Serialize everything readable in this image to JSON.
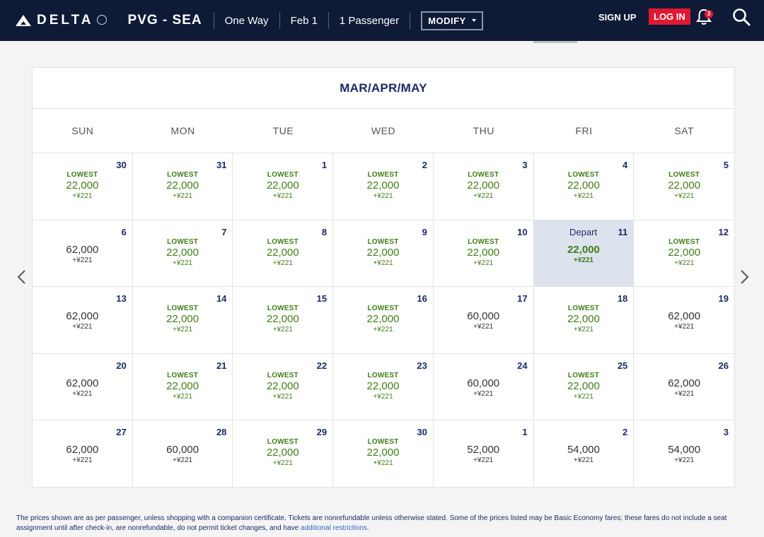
{
  "header": {
    "brand": "DELTA",
    "route": "PVG - SEA",
    "trip_type": "One Way",
    "date": "Feb 1",
    "passengers": "1 Passenger",
    "modify_label": "MODIFY",
    "signup_label": "SIGN UP",
    "login_label": "LOG IN",
    "notification_count": "3",
    "icons": {
      "search": "search-icon",
      "bell": "bell-icon",
      "dropdown": "chevron-down-icon"
    }
  },
  "calendar": {
    "title": "MAR/APR/MAY",
    "weekdays": [
      "SUN",
      "MON",
      "TUE",
      "WED",
      "THU",
      "FRI",
      "SAT"
    ],
    "lowest_label": "LOWEST",
    "depart_label": "Depart",
    "selected_day": "11",
    "days": [
      {
        "day": "30",
        "lowest": true,
        "price": "22,000",
        "tax": "+¥221"
      },
      {
        "day": "31",
        "lowest": true,
        "price": "22,000",
        "tax": "+¥221"
      },
      {
        "day": "1",
        "lowest": true,
        "price": "22,000",
        "tax": "+¥221"
      },
      {
        "day": "2",
        "lowest": true,
        "price": "22,000",
        "tax": "+¥221"
      },
      {
        "day": "3",
        "lowest": true,
        "price": "22,000",
        "tax": "+¥221"
      },
      {
        "day": "4",
        "lowest": true,
        "price": "22,000",
        "tax": "+¥221"
      },
      {
        "day": "5",
        "lowest": true,
        "price": "22,000",
        "tax": "+¥221"
      },
      {
        "day": "6",
        "lowest": false,
        "price": "62,000",
        "tax": "+¥221"
      },
      {
        "day": "7",
        "lowest": true,
        "price": "22,000",
        "tax": "+¥221"
      },
      {
        "day": "8",
        "lowest": true,
        "price": "22,000",
        "tax": "+¥221"
      },
      {
        "day": "9",
        "lowest": true,
        "price": "22,000",
        "tax": "+¥221"
      },
      {
        "day": "10",
        "lowest": true,
        "price": "22,000",
        "tax": "+¥221"
      },
      {
        "day": "11",
        "lowest": false,
        "selected": true,
        "price": "22,000",
        "tax": "+¥221"
      },
      {
        "day": "12",
        "lowest": true,
        "price": "22,000",
        "tax": "+¥221"
      },
      {
        "day": "13",
        "lowest": false,
        "price": "62,000",
        "tax": "+¥221"
      },
      {
        "day": "14",
        "lowest": true,
        "price": "22,000",
        "tax": "+¥221"
      },
      {
        "day": "15",
        "lowest": true,
        "price": "22,000",
        "tax": "+¥221"
      },
      {
        "day": "16",
        "lowest": true,
        "price": "22,000",
        "tax": "+¥221"
      },
      {
        "day": "17",
        "lowest": false,
        "price": "60,000",
        "tax": "+¥221"
      },
      {
        "day": "18",
        "lowest": true,
        "price": "22,000",
        "tax": "+¥221"
      },
      {
        "day": "19",
        "lowest": false,
        "price": "62,000",
        "tax": "+¥221"
      },
      {
        "day": "20",
        "lowest": false,
        "price": "62,000",
        "tax": "+¥221"
      },
      {
        "day": "21",
        "lowest": true,
        "price": "22,000",
        "tax": "+¥221"
      },
      {
        "day": "22",
        "lowest": true,
        "price": "22,000",
        "tax": "+¥221"
      },
      {
        "day": "23",
        "lowest": true,
        "price": "22,000",
        "tax": "+¥221"
      },
      {
        "day": "24",
        "lowest": false,
        "price": "60,000",
        "tax": "+¥221"
      },
      {
        "day": "25",
        "lowest": true,
        "price": "22,000",
        "tax": "+¥221"
      },
      {
        "day": "26",
        "lowest": false,
        "price": "62,000",
        "tax": "+¥221"
      },
      {
        "day": "27",
        "lowest": false,
        "price": "62,000",
        "tax": "+¥221"
      },
      {
        "day": "28",
        "lowest": false,
        "price": "60,000",
        "tax": "+¥221"
      },
      {
        "day": "29",
        "lowest": true,
        "price": "22,000",
        "tax": "+¥221"
      },
      {
        "day": "30",
        "lowest": true,
        "price": "22,000",
        "tax": "+¥221"
      },
      {
        "day": "1",
        "lowest": false,
        "price": "52,000",
        "tax": "+¥221"
      },
      {
        "day": "2",
        "lowest": false,
        "price": "54,000",
        "tax": "+¥221"
      },
      {
        "day": "3",
        "lowest": false,
        "price": "54,000",
        "tax": "+¥221"
      }
    ]
  },
  "footer": {
    "note": "The prices shown are as per passenger, unless shopping with a companion certificate. Tickets are nonrefundable unless otherwise stated. Some of the prices listed may be Basic Economy fares; these fares do not include a seat assignment until after check-in, are nonrefundable, do not permit ticket changes, and have ",
    "link": "additional restrictions",
    "end": "."
  },
  "colors": {
    "nav_bg": "#0f1a37",
    "login_red": "#e01933",
    "lowest_green": "#3f7d17",
    "title_navy": "#1b2b66",
    "selected_bg": "#dde3ed"
  }
}
